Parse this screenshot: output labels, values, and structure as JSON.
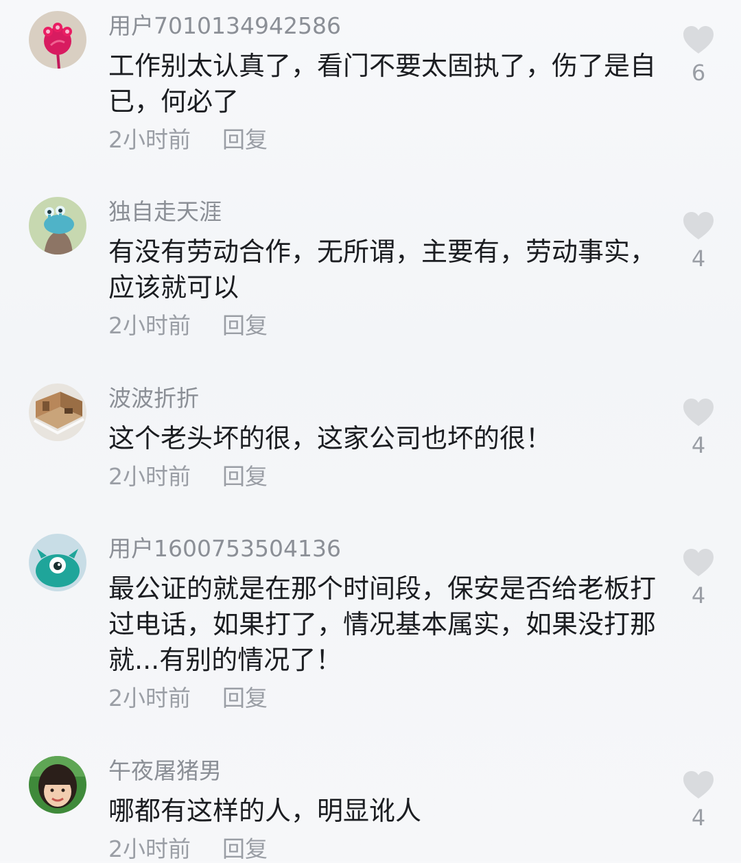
{
  "comments": [
    {
      "username": "用户7010134942586",
      "content": "工作别太认真了，看门不要太固执了，伤了是自已，何必了",
      "time": "2小时前",
      "reply_label": "回复",
      "likes": "6",
      "avatar_icon": "red-flower-avatar"
    },
    {
      "username": "独自走天涯",
      "content": "有没有劳动合作，无所谓，主要有，劳动事实，应该就可以",
      "time": "2小时前",
      "reply_label": "回复",
      "likes": "4",
      "avatar_icon": "cartoon-creature-avatar"
    },
    {
      "username": "波波折折",
      "content": "这个老头坏的很，这家公司也坏的很！",
      "time": "2小时前",
      "reply_label": "回复",
      "likes": "4",
      "avatar_icon": "room-interior-avatar"
    },
    {
      "username": "用户1600753504136",
      "content": "最公证的就是在那个时间段，保安是否给老板打过电话，如果打了，情况基本属实，如果没打那就...有别的情况了！",
      "time": "2小时前",
      "reply_label": "回复",
      "likes": "4",
      "avatar_icon": "teal-monster-avatar"
    },
    {
      "username": "午夜屠猪男",
      "content": "哪都有这样的人，明显讹人",
      "time": "2小时前",
      "reply_label": "回复",
      "likes": "4",
      "avatar_icon": "child-photo-avatar"
    }
  ],
  "colors": {
    "username": "#8b8f96",
    "content": "#1b1d21",
    "meta": "#9a9ea5",
    "heart": "#d9dbde"
  }
}
